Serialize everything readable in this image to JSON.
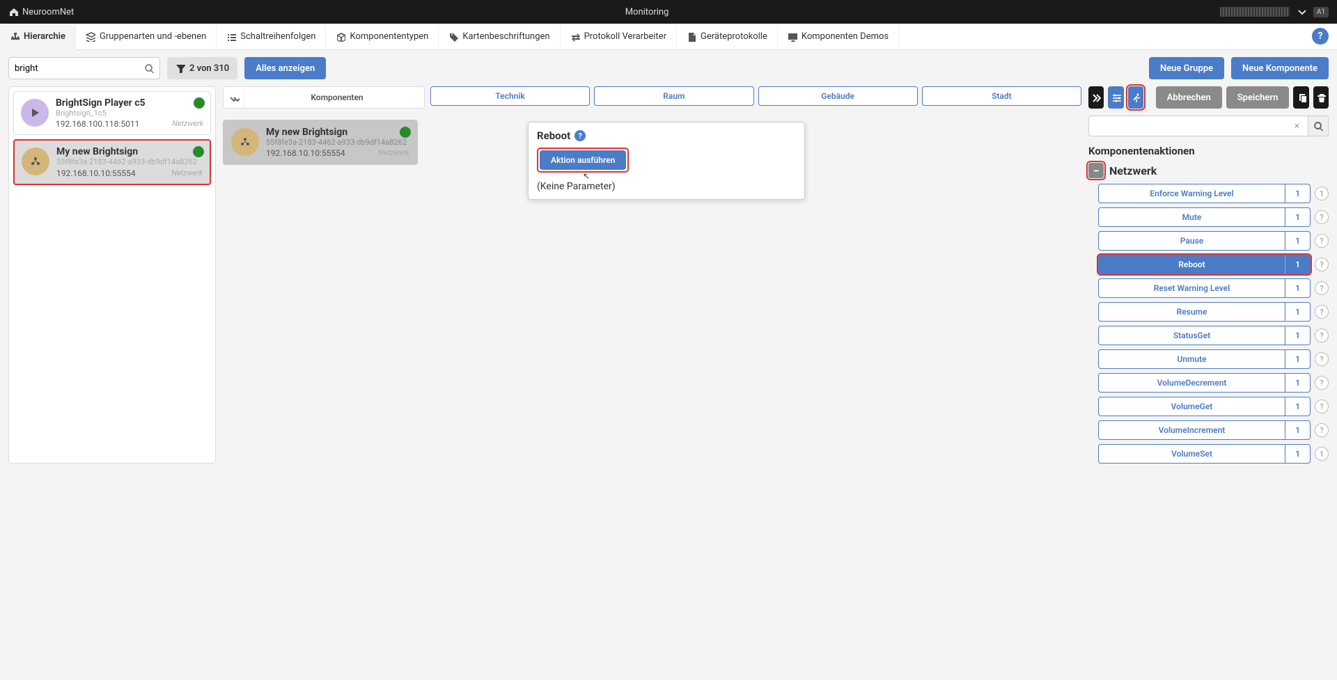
{
  "topbar": {
    "brand": "NeuroomNet",
    "title": "Monitoring",
    "kbd": "A1"
  },
  "navtabs": [
    {
      "icon": "sitemap",
      "label": "Hierarchie",
      "active": true
    },
    {
      "icon": "layers",
      "label": "Gruppenarten und -ebenen"
    },
    {
      "icon": "list",
      "label": "Schaltreihenfolgen"
    },
    {
      "icon": "cube",
      "label": "Komponententypen"
    },
    {
      "icon": "tags",
      "label": "Kartenbeschriftungen"
    },
    {
      "icon": "exchange",
      "label": "Protokoll Verarbeiter"
    },
    {
      "icon": "file",
      "label": "Geräteprotokolle"
    },
    {
      "icon": "desktop",
      "label": "Komponenten Demos"
    }
  ],
  "toolbar": {
    "search_value": "bright",
    "filter_count": "2 von 310",
    "show_all": "Alles anzeigen",
    "new_group": "Neue Gruppe",
    "new_component": "Neue Komponente"
  },
  "left_cards": [
    {
      "title": "BrightSign Player c5",
      "sub": "Brightsign_1c5",
      "addr": "192.168.100.118:5011",
      "net": "Netzwerk",
      "icon": "play",
      "selected": false,
      "highlight": false
    },
    {
      "title": "My new Brightsign",
      "sub": "55f8fe3a-2183-4462-a933-db9df14a8262",
      "addr": "192.168.10.10:55554",
      "net": "Netzwerk",
      "icon": "nodes",
      "selected": true,
      "highlight": true
    }
  ],
  "mid": {
    "header_label": "Komponenten",
    "pills": [
      "Technik",
      "Raum",
      "Gebäude",
      "Stadt"
    ],
    "card": {
      "title": "My new Brightsign",
      "sub": "55f8fe3a-2183-4462-a933-db9df14a8262",
      "addr": "192.168.10.10:55554",
      "net": "Netzwerk"
    }
  },
  "popup": {
    "title": "Reboot",
    "execute": "Aktion ausführen",
    "params": "(Keine Parameter)"
  },
  "right": {
    "cancel": "Abbrechen",
    "save": "Speichern",
    "section": "Komponentenaktionen",
    "subsection": "Netzwerk",
    "actions": [
      {
        "label": "Enforce Warning Level",
        "count": "1",
        "help": "1"
      },
      {
        "label": "Mute",
        "count": "1",
        "help": "?"
      },
      {
        "label": "Pause",
        "count": "1",
        "help": "?"
      },
      {
        "label": "Reboot",
        "count": "1",
        "help": "?",
        "selected": true,
        "highlight": true
      },
      {
        "label": "Reset Warning Level",
        "count": "1",
        "help": "?"
      },
      {
        "label": "Resume",
        "count": "1",
        "help": "?"
      },
      {
        "label": "StatusGet",
        "count": "1",
        "help": "?"
      },
      {
        "label": "Unmute",
        "count": "1",
        "help": "?"
      },
      {
        "label": "VolumeDecrement",
        "count": "1",
        "help": "?"
      },
      {
        "label": "VolumeGet",
        "count": "1",
        "help": "?"
      },
      {
        "label": "VolumeIncrement",
        "count": "1",
        "help": "?"
      },
      {
        "label": "VolumeSet",
        "count": "1",
        "help": "1"
      }
    ]
  }
}
